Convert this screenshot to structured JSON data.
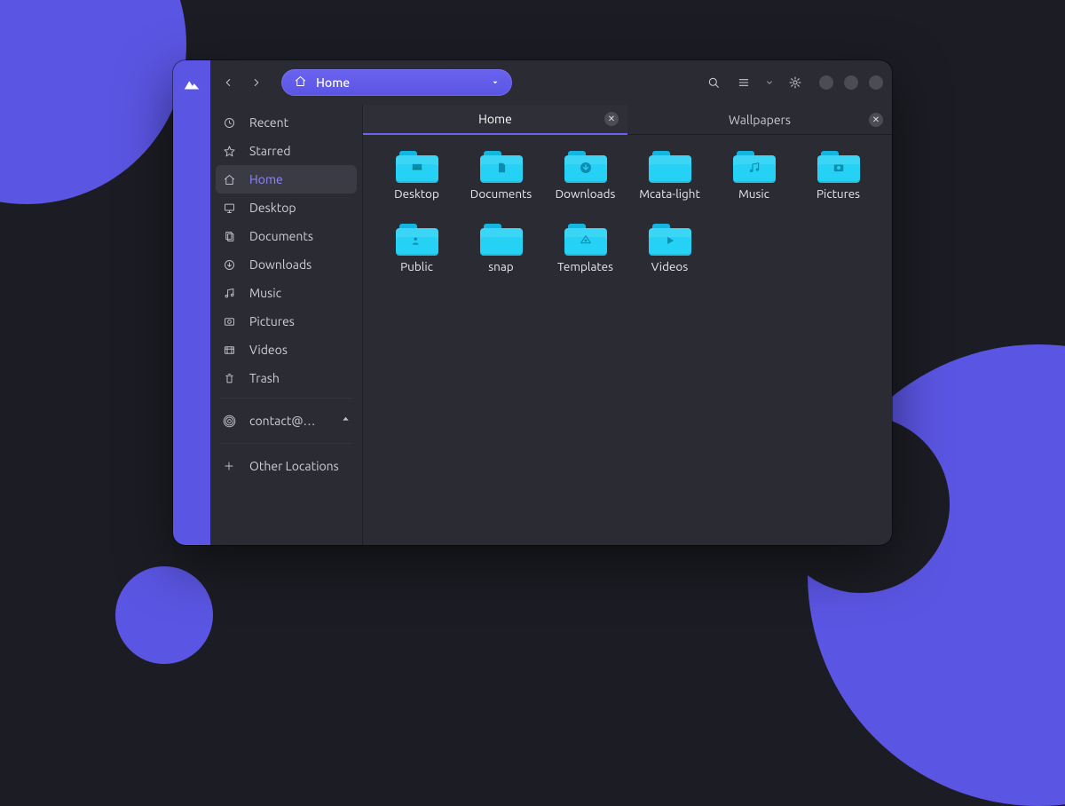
{
  "path": {
    "label": "Home"
  },
  "sidebar": {
    "items": [
      {
        "label": "Recent"
      },
      {
        "label": "Starred"
      },
      {
        "label": "Home"
      },
      {
        "label": "Desktop"
      },
      {
        "label": "Documents"
      },
      {
        "label": "Downloads"
      },
      {
        "label": "Music"
      },
      {
        "label": "Pictures"
      },
      {
        "label": "Videos"
      },
      {
        "label": "Trash"
      }
    ],
    "mount": {
      "label": "contact@…"
    },
    "other": {
      "label": "Other Locations"
    }
  },
  "tabs": [
    {
      "label": "Home"
    },
    {
      "label": "Wallpapers"
    }
  ],
  "folders": [
    {
      "label": "Desktop"
    },
    {
      "label": "Documents"
    },
    {
      "label": "Downloads"
    },
    {
      "label": "Mcata-light"
    },
    {
      "label": "Music"
    },
    {
      "label": "Pictures"
    },
    {
      "label": "Public"
    },
    {
      "label": "snap"
    },
    {
      "label": "Templates"
    },
    {
      "label": "Videos"
    }
  ]
}
